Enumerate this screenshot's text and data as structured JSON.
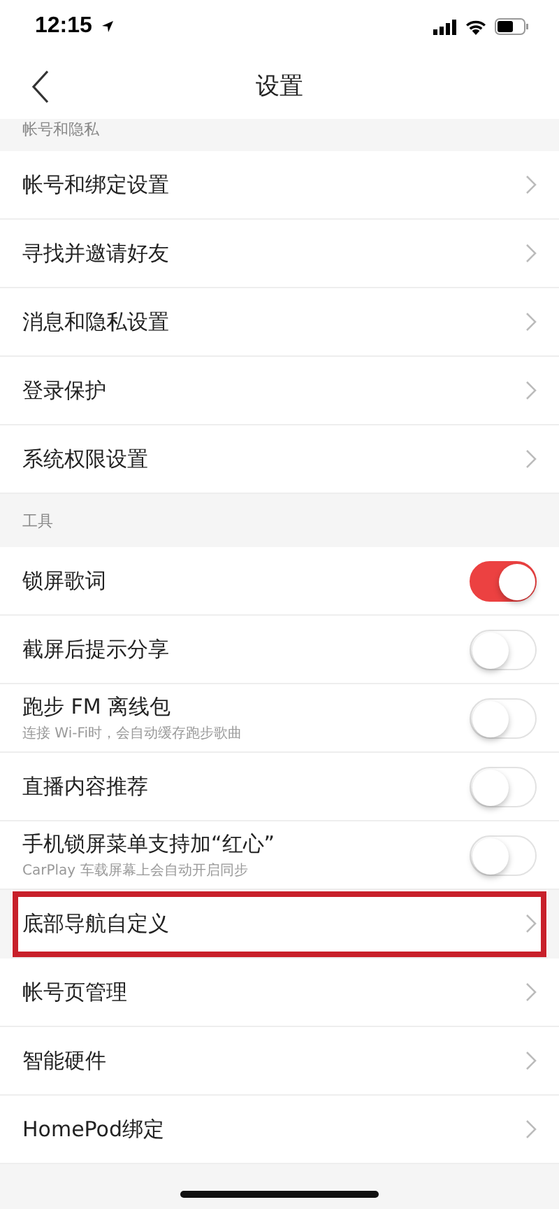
{
  "status_bar": {
    "time": "12:15"
  },
  "nav": {
    "title": "设置"
  },
  "sections": [
    {
      "header": "帐号和隐私",
      "items": [
        {
          "kind": "link",
          "label": "帐号和绑定设置",
          "highlighted": false
        },
        {
          "kind": "link",
          "label": "寻找并邀请好友",
          "highlighted": false
        },
        {
          "kind": "link",
          "label": "消息和隐私设置",
          "highlighted": false
        },
        {
          "kind": "link",
          "label": "登录保护",
          "highlighted": false
        },
        {
          "kind": "link",
          "label": "系统权限设置",
          "highlighted": false
        }
      ]
    },
    {
      "header": "工具",
      "items": [
        {
          "kind": "toggle",
          "label": "锁屏歌词",
          "on": true
        },
        {
          "kind": "toggle",
          "label": "截屏后提示分享",
          "on": false
        },
        {
          "kind": "toggle",
          "label": "跑步 FM 离线包",
          "subtitle": "连接 Wi-Fi时，会自动缓存跑步歌曲",
          "on": false
        },
        {
          "kind": "toggle",
          "label": "直播内容推荐",
          "on": false
        },
        {
          "kind": "toggle",
          "label": "手机锁屏菜单支持加“红心”",
          "subtitle": "CarPlay 车载屏幕上会自动开启同步",
          "on": false
        },
        {
          "kind": "link",
          "label": "底部导航自定义",
          "highlighted": true
        },
        {
          "kind": "link",
          "label": "帐号页管理",
          "highlighted": false
        },
        {
          "kind": "link",
          "label": "智能硬件",
          "highlighted": false
        },
        {
          "kind": "link",
          "label": "HomePod绑定",
          "highlighted": false
        }
      ]
    }
  ]
}
